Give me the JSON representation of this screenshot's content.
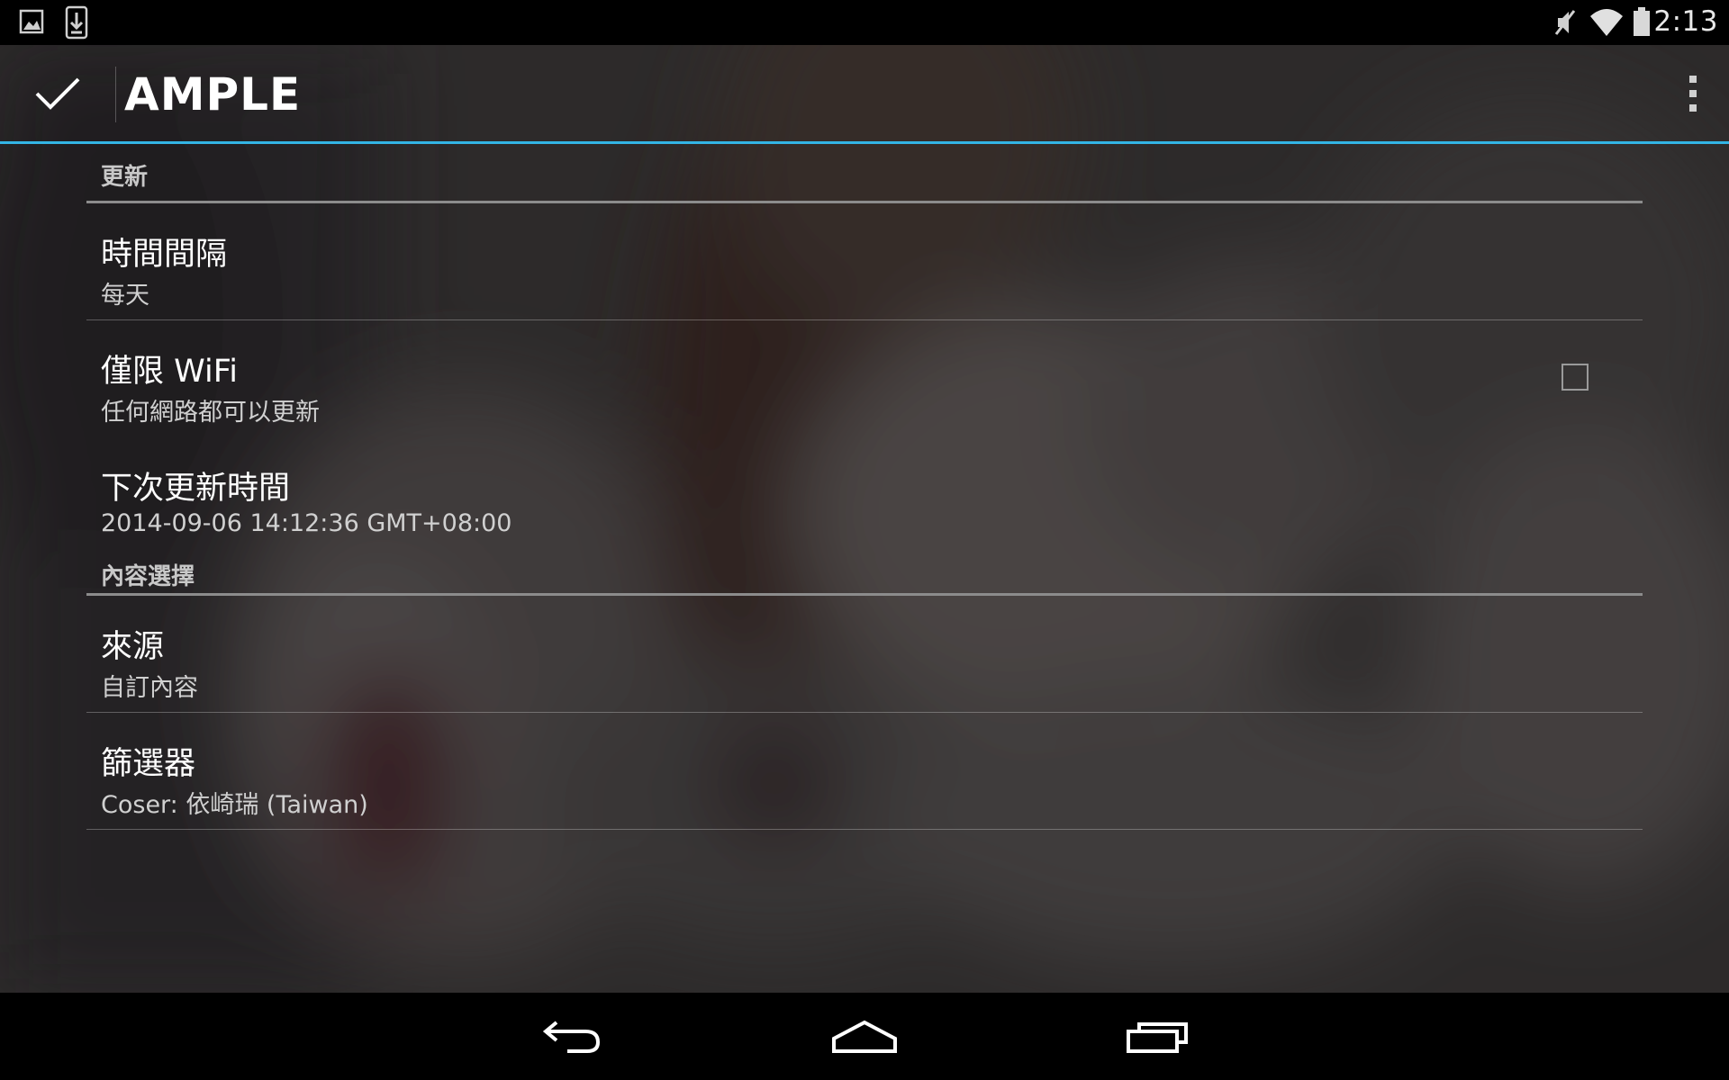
{
  "status_bar": {
    "time": "2:13",
    "icons": [
      "gallery-notification-icon",
      "download-notification-icon",
      "mute-icon",
      "wifi-icon",
      "battery-icon"
    ]
  },
  "action_bar": {
    "title": "AMPLE",
    "done_icon": "check-icon",
    "overflow_icon": "overflow-menu-icon",
    "accent_color": "#33b5e5"
  },
  "categories": {
    "update": {
      "title": "更新",
      "prefs": {
        "interval": {
          "title": "時間間隔",
          "summary": "每天"
        },
        "wifi_only": {
          "title": "僅限 WiFi",
          "summary": "任何網路都可以更新",
          "checked": false
        },
        "next_update": {
          "title": "下次更新時間",
          "summary": "2014-09-06 14:12:36 GMT+08:00"
        }
      }
    },
    "content": {
      "title": "內容選擇",
      "prefs": {
        "source": {
          "title": "來源",
          "summary": "自訂內容"
        },
        "filter": {
          "title": "篩選器",
          "summary": "Coser: 依崎瑞 (Taiwan)"
        }
      }
    }
  },
  "nav_bar": {
    "icons": [
      "back-icon",
      "home-icon",
      "recents-icon"
    ]
  }
}
